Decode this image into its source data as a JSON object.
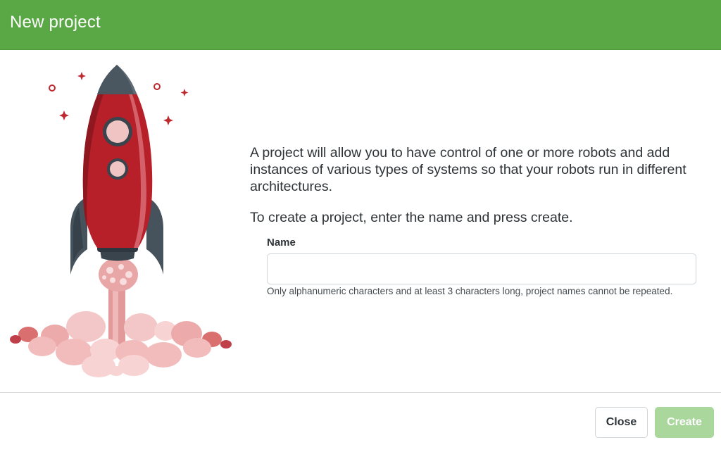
{
  "dialog": {
    "title": "New project",
    "description": "A project will allow you to have control of one or more robots and add instances of various types of systems so that your robots run in different architectures.",
    "instruction": "To create a project, enter the name and press create.",
    "name_label": "Name",
    "name_value": "",
    "name_placeholder": "",
    "help_text": "Only alphanumeric characters and at least 3 characters long, project names cannot be repeated.",
    "close_label": "Close",
    "create_label": "Create",
    "create_disabled": true
  },
  "illustration": {
    "icon": "rocket-launch-illustration"
  },
  "colors": {
    "header": "#5aa845",
    "rocket_body": "#b71f29",
    "rocket_dark": "#3f4a53",
    "smoke": "#f2bcbc",
    "create_disabled": "#a9d79c"
  }
}
